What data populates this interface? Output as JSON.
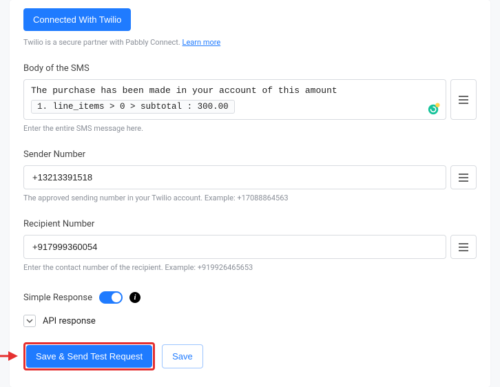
{
  "twilio": {
    "connected_btn": "Connected With Twilio",
    "partner_text": "Twilio is a secure partner with Pabbly Connect. ",
    "learn_more": "Learn more"
  },
  "sms_body": {
    "label": "Body of the SMS",
    "text": "The purchase has been made in your account of this amount",
    "chip_num": "1.",
    "chip_path": "line_items > 0 > subtotal : ",
    "chip_val": "300.00",
    "help": "Enter the entire SMS message here."
  },
  "sender": {
    "label": "Sender Number",
    "value": "+13213391518",
    "help": "The approved sending number in your Twilio account. Example: +17088864563"
  },
  "recipient": {
    "label": "Recipient Number",
    "value": "+917999360054",
    "help": "Enter the contact number of the recipient. Example: +919926465653"
  },
  "simple_response": {
    "label": "Simple Response"
  },
  "api_response": {
    "label": "API response"
  },
  "actions": {
    "primary": "Save & Send Test Request",
    "secondary": "Save"
  }
}
